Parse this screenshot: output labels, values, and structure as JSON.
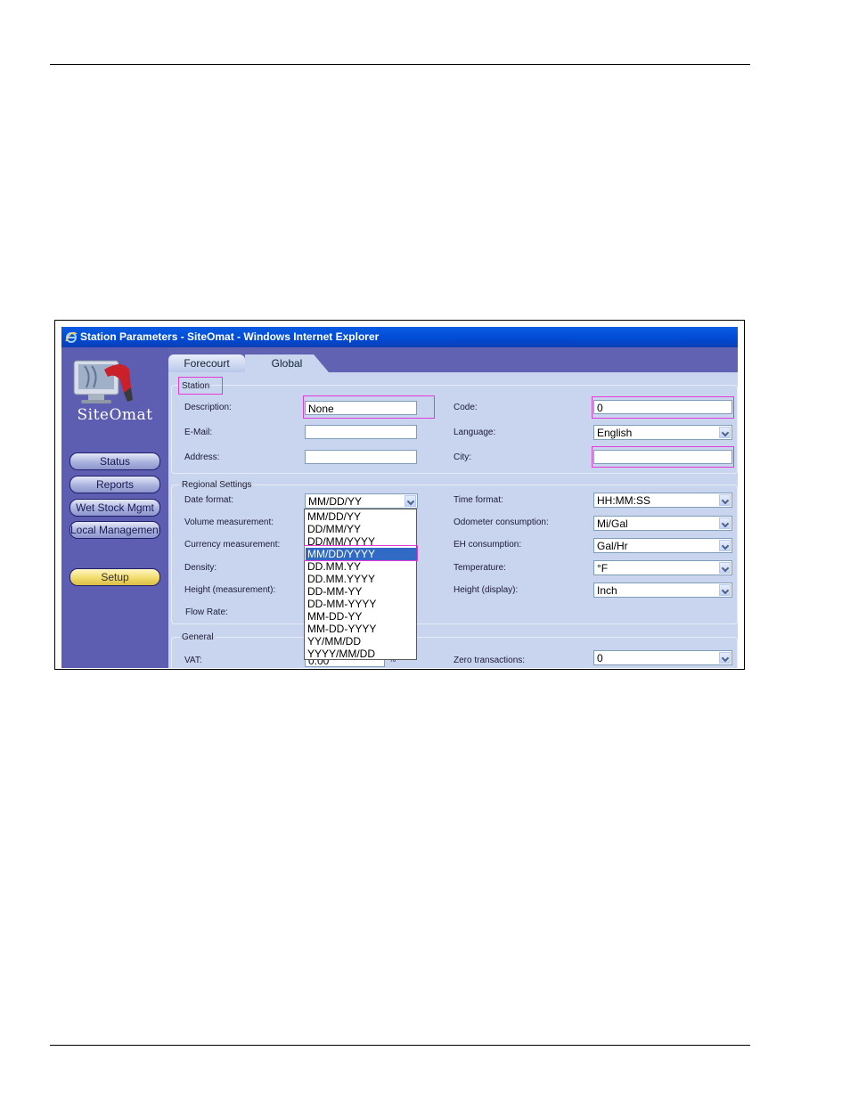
{
  "window": {
    "title": "Station Parameters - SiteOmat - Windows Internet Explorer"
  },
  "sidebar": {
    "logo_text": "SiteOmat",
    "nav": [
      {
        "label": "Status"
      },
      {
        "label": "Reports"
      },
      {
        "label": "Wet Stock Mgmt"
      },
      {
        "label": "Local Management"
      },
      {
        "label": "Setup",
        "active": true
      }
    ]
  },
  "tabs": [
    {
      "label": "Forecourt"
    },
    {
      "label": "Global",
      "active": true
    }
  ],
  "station": {
    "legend": "Station",
    "description_label": "Description:",
    "description_value": "None",
    "email_label": "E-Mail:",
    "email_value": "",
    "address_label": "Address:",
    "address_value": "",
    "code_label": "Code:",
    "code_value": "0",
    "language_label": "Language:",
    "language_value": "English",
    "city_label": "City:",
    "city_value": ""
  },
  "regional": {
    "legend": "Regional Settings",
    "date_format_label": "Date format:",
    "date_format_value": "MM/DD/YY",
    "volume_label": "Volume measurement:",
    "currency_label": "Currency measurement:",
    "density_label": "Density:",
    "height_measurement_label": "Height (measurement):",
    "flow_rate_label": "Flow Rate:",
    "time_format_label": "Time format:",
    "time_format_value": "HH:MM:SS",
    "odometer_label": "Odometer consumption:",
    "odometer_value": "Mi/Gal",
    "eh_label": "EH consumption:",
    "eh_value": "Gal/Hr",
    "temperature_label": "Temperature:",
    "temperature_value": "°F",
    "height_display_label": "Height (display):",
    "height_display_value": "Inch"
  },
  "date_format_options": [
    "MM/DD/YY",
    "DD/MM/YY",
    "DD/MM/YYYY",
    "MM/DD/YYYY",
    "DD.MM.YY",
    "DD.MM.YYYY",
    "DD-MM-YY",
    "DD-MM-YYYY",
    "MM-DD-YY",
    "MM-DD-YYYY",
    "YY/MM/DD",
    "YYYY/MM/DD"
  ],
  "date_format_selected_index": 3,
  "general": {
    "legend": "General",
    "vat_label": "VAT:",
    "vat_value": "0.00",
    "vat_unit": "%",
    "zero_label": "Zero transactions:",
    "zero_value": "0"
  },
  "colors": {
    "titlebar": "#0149d3",
    "sidebar": "#5d5db2",
    "panel": "#c9d4ee",
    "highlight": "#e23bd6",
    "selection": "#316ac5"
  }
}
